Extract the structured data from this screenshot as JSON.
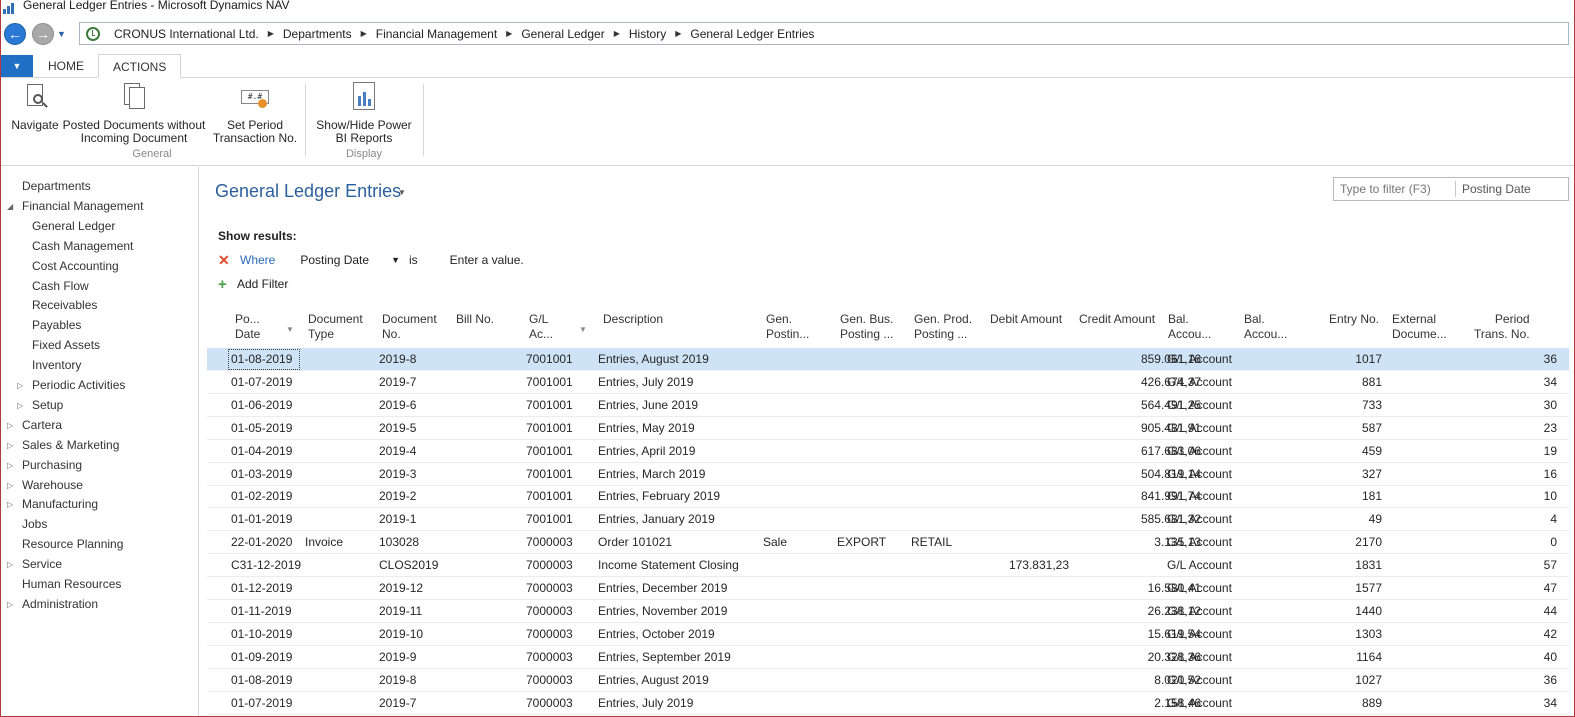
{
  "window": {
    "title": "General Ledger Entries - Microsoft Dynamics NAV"
  },
  "address": {
    "crumbs": [
      "CRONUS International Ltd.",
      "Departments",
      "Financial Management",
      "General Ledger",
      "History",
      "General Ledger Entries"
    ]
  },
  "tabs": [
    {
      "label": "HOME"
    },
    {
      "label": "ACTIONS"
    }
  ],
  "ribbon": {
    "group_general": "General",
    "group_display": "Display",
    "navigate": "Navigate",
    "posted_docs_1": "Posted Documents without",
    "posted_docs_2": "Incoming Document",
    "set_period_1": "Set Period",
    "set_period_2": "Transaction No.",
    "powerbi_1": "Show/Hide Power",
    "powerbi_2": "BI Reports"
  },
  "leftnav": {
    "items": [
      "Departments",
      "Financial Management",
      "General Ledger",
      "Cash Management",
      "Cost Accounting",
      "Cash Flow",
      "Receivables",
      "Payables",
      "Fixed Assets",
      "Inventory",
      "Periodic Activities",
      "Setup",
      "Cartera",
      "Sales & Marketing",
      "Purchasing",
      "Warehouse",
      "Manufacturing",
      "Jobs",
      "Resource Planning",
      "Service",
      "Human Resources",
      "Administration"
    ]
  },
  "page": {
    "title": "General Ledger Entries",
    "filter_placeholder": "Type to filter (F3)",
    "filter_field": "Posting Date",
    "show_results": "Show results:",
    "where": "Where",
    "filter_field_name": "Posting Date",
    "filter_is": "is",
    "filter_value": "Enter a value.",
    "add_filter": "Add Filter"
  },
  "table": {
    "headers": [
      [
        "Po...",
        "Date"
      ],
      [
        "Document",
        "Type"
      ],
      [
        "Document",
        "No."
      ],
      [
        "Bill No.",
        ""
      ],
      [
        "G/L",
        "Ac..."
      ],
      [
        "Description",
        ""
      ],
      [
        "Gen.",
        "Postin..."
      ],
      [
        "Gen. Bus.",
        "Posting ..."
      ],
      [
        "Gen. Prod.",
        "Posting ..."
      ],
      [
        "Debit Amount",
        ""
      ],
      [
        "Credit Amount",
        ""
      ],
      [
        "Bal.",
        "Accou..."
      ],
      [
        "Bal.",
        "Accou..."
      ],
      [
        "Entry No.",
        ""
      ],
      [
        "External",
        "Docume..."
      ],
      [
        "Period",
        "Trans. No."
      ]
    ],
    "rows": [
      [
        "01-08-2019",
        "",
        "2019-8",
        "",
        "7001001",
        "Entries, August 2019",
        "",
        "",
        "",
        "",
        "859.061,16",
        "G/L Account",
        "",
        "1017",
        "",
        "36"
      ],
      [
        "01-07-2019",
        "",
        "2019-7",
        "",
        "7001001",
        "Entries, July 2019",
        "",
        "",
        "",
        "",
        "426.674,37",
        "G/L Account",
        "",
        "881",
        "",
        "34"
      ],
      [
        "01-06-2019",
        "",
        "2019-6",
        "",
        "7001001",
        "Entries, June 2019",
        "",
        "",
        "",
        "",
        "564.491,25",
        "G/L Account",
        "",
        "733",
        "",
        "30"
      ],
      [
        "01-05-2019",
        "",
        "2019-5",
        "",
        "7001001",
        "Entries, May 2019",
        "",
        "",
        "",
        "",
        "905.481,91",
        "G/L Account",
        "",
        "587",
        "",
        "23"
      ],
      [
        "01-04-2019",
        "",
        "2019-4",
        "",
        "7001001",
        "Entries, April 2019",
        "",
        "",
        "",
        "",
        "617.683,06",
        "G/L Account",
        "",
        "459",
        "",
        "19"
      ],
      [
        "01-03-2019",
        "",
        "2019-3",
        "",
        "7001001",
        "Entries, March 2019",
        "",
        "",
        "",
        "",
        "504.819,14",
        "G/L Account",
        "",
        "327",
        "",
        "16"
      ],
      [
        "01-02-2019",
        "",
        "2019-2",
        "",
        "7001001",
        "Entries, February 2019",
        "",
        "",
        "",
        "",
        "841.991,74",
        "G/L Account",
        "",
        "181",
        "",
        "10"
      ],
      [
        "01-01-2019",
        "",
        "2019-1",
        "",
        "7001001",
        "Entries, January 2019",
        "",
        "",
        "",
        "",
        "585.681,32",
        "G/L Account",
        "",
        "49",
        "",
        "4"
      ],
      [
        "22-01-2020",
        "Invoice",
        "103028",
        "",
        "7000003",
        "Order 101021",
        "Sale",
        "EXPORT",
        "RETAIL",
        "",
        "3.135,13",
        "G/L Account",
        "",
        "2170",
        "",
        "0"
      ],
      [
        "C31-12-2019",
        "",
        "CLOS2019",
        "",
        "7000003",
        "Income Statement Closing",
        "",
        "",
        "",
        "173.831,23",
        "",
        "G/L Account",
        "",
        "1831",
        "",
        "57"
      ],
      [
        "01-12-2019",
        "",
        "2019-12",
        "",
        "7000003",
        "Entries, December 2019",
        "",
        "",
        "",
        "",
        "16.580,41",
        "G/L Account",
        "",
        "1577",
        "",
        "47"
      ],
      [
        "01-11-2019",
        "",
        "2019-11",
        "",
        "7000003",
        "Entries, November 2019",
        "",
        "",
        "",
        "",
        "26.238,12",
        "G/L Account",
        "",
        "1440",
        "",
        "44"
      ],
      [
        "01-10-2019",
        "",
        "2019-10",
        "",
        "7000003",
        "Entries, October 2019",
        "",
        "",
        "",
        "",
        "15.619,54",
        "G/L Account",
        "",
        "1303",
        "",
        "42"
      ],
      [
        "01-09-2019",
        "",
        "2019-9",
        "",
        "7000003",
        "Entries, September 2019",
        "",
        "",
        "",
        "",
        "20.328,36",
        "G/L Account",
        "",
        "1164",
        "",
        "40"
      ],
      [
        "01-08-2019",
        "",
        "2019-8",
        "",
        "7000003",
        "Entries, August 2019",
        "",
        "",
        "",
        "",
        "8.020,52",
        "G/L Account",
        "",
        "1027",
        "",
        "36"
      ],
      [
        "01-07-2019",
        "",
        "2019-7",
        "",
        "7000003",
        "Entries, July 2019",
        "",
        "",
        "",
        "",
        "2.158,46",
        "G/L Account",
        "",
        "889",
        "",
        "34"
      ]
    ]
  },
  "colors": {
    "accent": "#2c5f9e",
    "selected_row": "#cfe3f6",
    "tab_file": "#1f6fc5"
  }
}
